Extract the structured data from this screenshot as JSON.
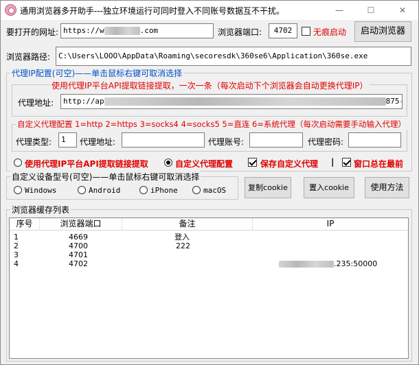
{
  "window": {
    "title": "通用浏览器多开助手---独立环境运行可同时登入不同账号数据互不干扰。",
    "minimize": "—",
    "maximize": "☐",
    "close": "✕"
  },
  "top": {
    "url_label": "要打开的网址:",
    "url_value": "https://w",
    "url_value_tail": ".com",
    "port_label": "浏览器端口:",
    "port_value": "4702",
    "incognito_label": "无痕启动",
    "launch_label": "启动浏览器",
    "path_label": "浏览器路径:",
    "path_value": "C:\\Users\\LOOO\\AppData\\Roaming\\secoresdk\\360se6\\Application\\360se.exe"
  },
  "proxy": {
    "group_title": "代理IP配置(可空)——单击鼠标右键可取消选择",
    "api_hint": "使用代理IP平台API提取链接提取，一次一条（每次启动下个浏览器会自动更换代理IP）",
    "proxy_addr_label": "代理地址:",
    "proxy_addr_value": "http://ap",
    "proxy_addr_tail": "875-",
    "custom_title": "自定义代理配置 1=http 2=https 3=socks4 4=socks5 5=直连 6=系统代理（每次启动需要手动输入代理）",
    "type_label": "代理类型:",
    "type_value": "1",
    "custom_addr_label": "代理地址:",
    "account_label": "代理账号:",
    "password_label": "代理密码:"
  },
  "options": {
    "use_api_label": "使用代理IP平台API提取链接提取",
    "custom_label": "自定义代理配置",
    "save_custom_label": "保存自定义代理",
    "separator": "|",
    "topmost_label": "窗口总在最前"
  },
  "device": {
    "group_title": "自定义设备型号(可空)——单击鼠标右键可取消选择",
    "windows": "Windows",
    "android": "Android",
    "iphone": "iPhone",
    "macos": "macOS",
    "copy_cookie": "复制cookie",
    "set_cookie": "置入cookie",
    "help": "使用方法"
  },
  "cache": {
    "group_title": "浏览器缓存列表",
    "headers": [
      "序号",
      "浏览器端口",
      "备注",
      "IP"
    ],
    "rows": [
      {
        "index": "1",
        "port": "4669",
        "note": "登入",
        "ip": ""
      },
      {
        "index": "2",
        "port": "4700",
        "note": "222",
        "ip": ""
      },
      {
        "index": "3",
        "port": "4701",
        "note": "",
        "ip": ""
      },
      {
        "index": "4",
        "port": "4702",
        "note": "",
        "ip": ".235:50000"
      }
    ]
  }
}
